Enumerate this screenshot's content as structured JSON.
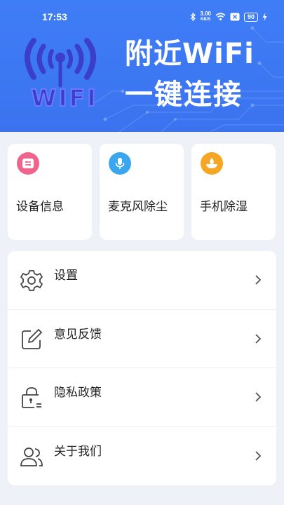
{
  "status_bar": {
    "time": "17:53",
    "net_speed_value": "3.00",
    "net_speed_unit": "KB/S",
    "battery": "90",
    "icons": [
      "bluetooth-icon",
      "wifi-signal-icon",
      "sim-blocked-icon",
      "battery-icon",
      "charging-icon"
    ]
  },
  "banner": {
    "logo_text": "WIFI",
    "title_line1": "附近WiFi",
    "title_line2": "一键连接",
    "colors": {
      "background": "#3f7df7",
      "logo": "#3b3ec9"
    }
  },
  "tools": [
    {
      "label": "设备信息",
      "icon": "device-info-icon",
      "color": "#f0638c"
    },
    {
      "label": "麦克风除尘",
      "icon": "microphone-icon",
      "color": "#3aa6f0"
    },
    {
      "label": "手机除湿",
      "icon": "dehumidify-icon",
      "color": "#f5a623"
    }
  ],
  "menu": [
    {
      "label": "设置",
      "icon": "gear-icon"
    },
    {
      "label": "意见反馈",
      "icon": "edit-feedback-icon"
    },
    {
      "label": "隐私政策",
      "icon": "privacy-lock-icon"
    },
    {
      "label": "关于我们",
      "icon": "users-icon"
    }
  ]
}
